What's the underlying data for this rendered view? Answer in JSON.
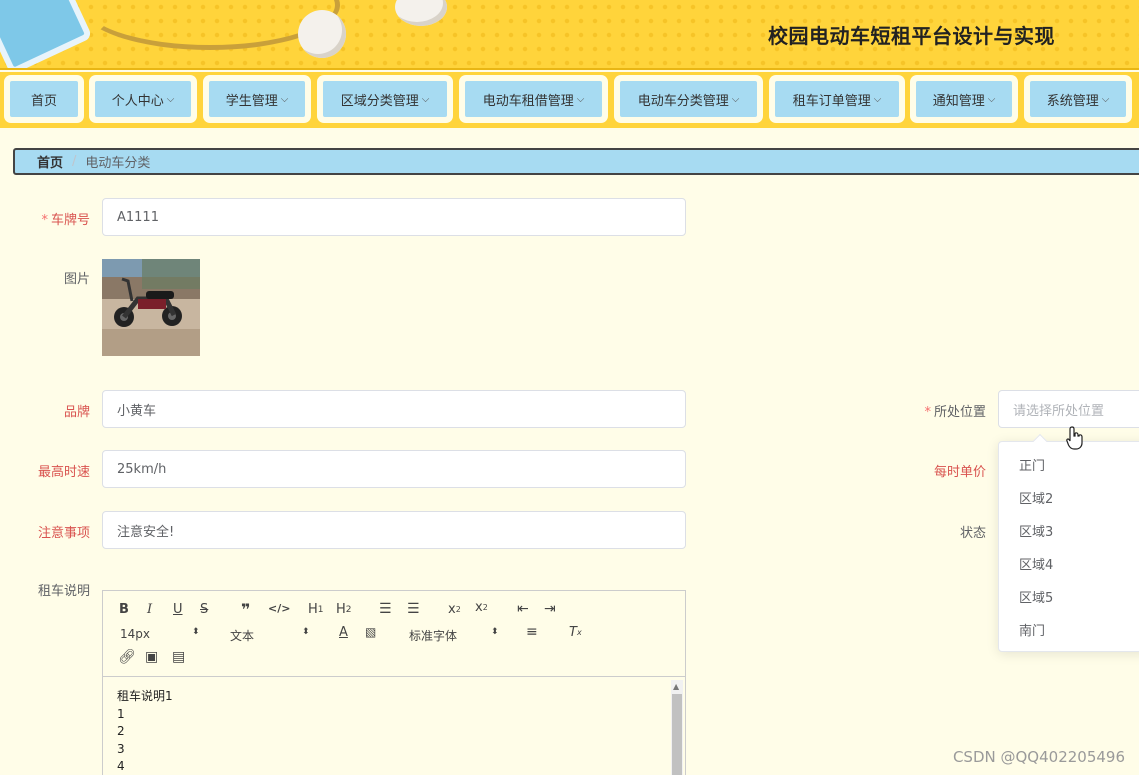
{
  "header": {
    "title": "校园电动车短租平台设计与实现"
  },
  "nav": {
    "items": [
      {
        "label": "首页",
        "dropdown": false
      },
      {
        "label": "个人中心",
        "dropdown": true
      },
      {
        "label": "学生管理",
        "dropdown": true
      },
      {
        "label": "区域分类管理",
        "dropdown": true
      },
      {
        "label": "电动车租借管理",
        "dropdown": true
      },
      {
        "label": "电动车分类管理",
        "dropdown": true
      },
      {
        "label": "租车订单管理",
        "dropdown": true
      },
      {
        "label": "通知管理",
        "dropdown": true
      },
      {
        "label": "系统管理",
        "dropdown": true
      }
    ]
  },
  "breadcrumb": {
    "home": "首页",
    "separator": "/",
    "current": "电动车分类"
  },
  "form": {
    "plate": {
      "label": "车牌号",
      "value": "A1111",
      "required": true
    },
    "image": {
      "label": "图片"
    },
    "brand": {
      "label": "品牌",
      "value": "小黄车"
    },
    "speed": {
      "label": "最高时速",
      "value": "25km/h"
    },
    "notice": {
      "label": "注意事项",
      "value": "注意安全!"
    },
    "desc": {
      "label": "租车说明"
    },
    "location": {
      "label": "所处位置",
      "placeholder": "请选择所处位置",
      "required": true
    },
    "price": {
      "label": "每时单价"
    },
    "status": {
      "label": "状态"
    }
  },
  "location_options": [
    "正门",
    "区域2",
    "区域3",
    "区域4",
    "区域5",
    "南门"
  ],
  "editor": {
    "toolbar": {
      "font_size": "14px",
      "text_style": "文本",
      "font_family": "标准字体"
    },
    "content_lines": [
      "租车说明1",
      "1",
      "2",
      "3",
      "4"
    ]
  },
  "watermark": "CSDN @QQ402205496",
  "colors": {
    "header_bg": "#ffd43b",
    "nav_button": "#a7dbf2",
    "page_bg": "#fffde8",
    "label_red": "#d9534f"
  }
}
